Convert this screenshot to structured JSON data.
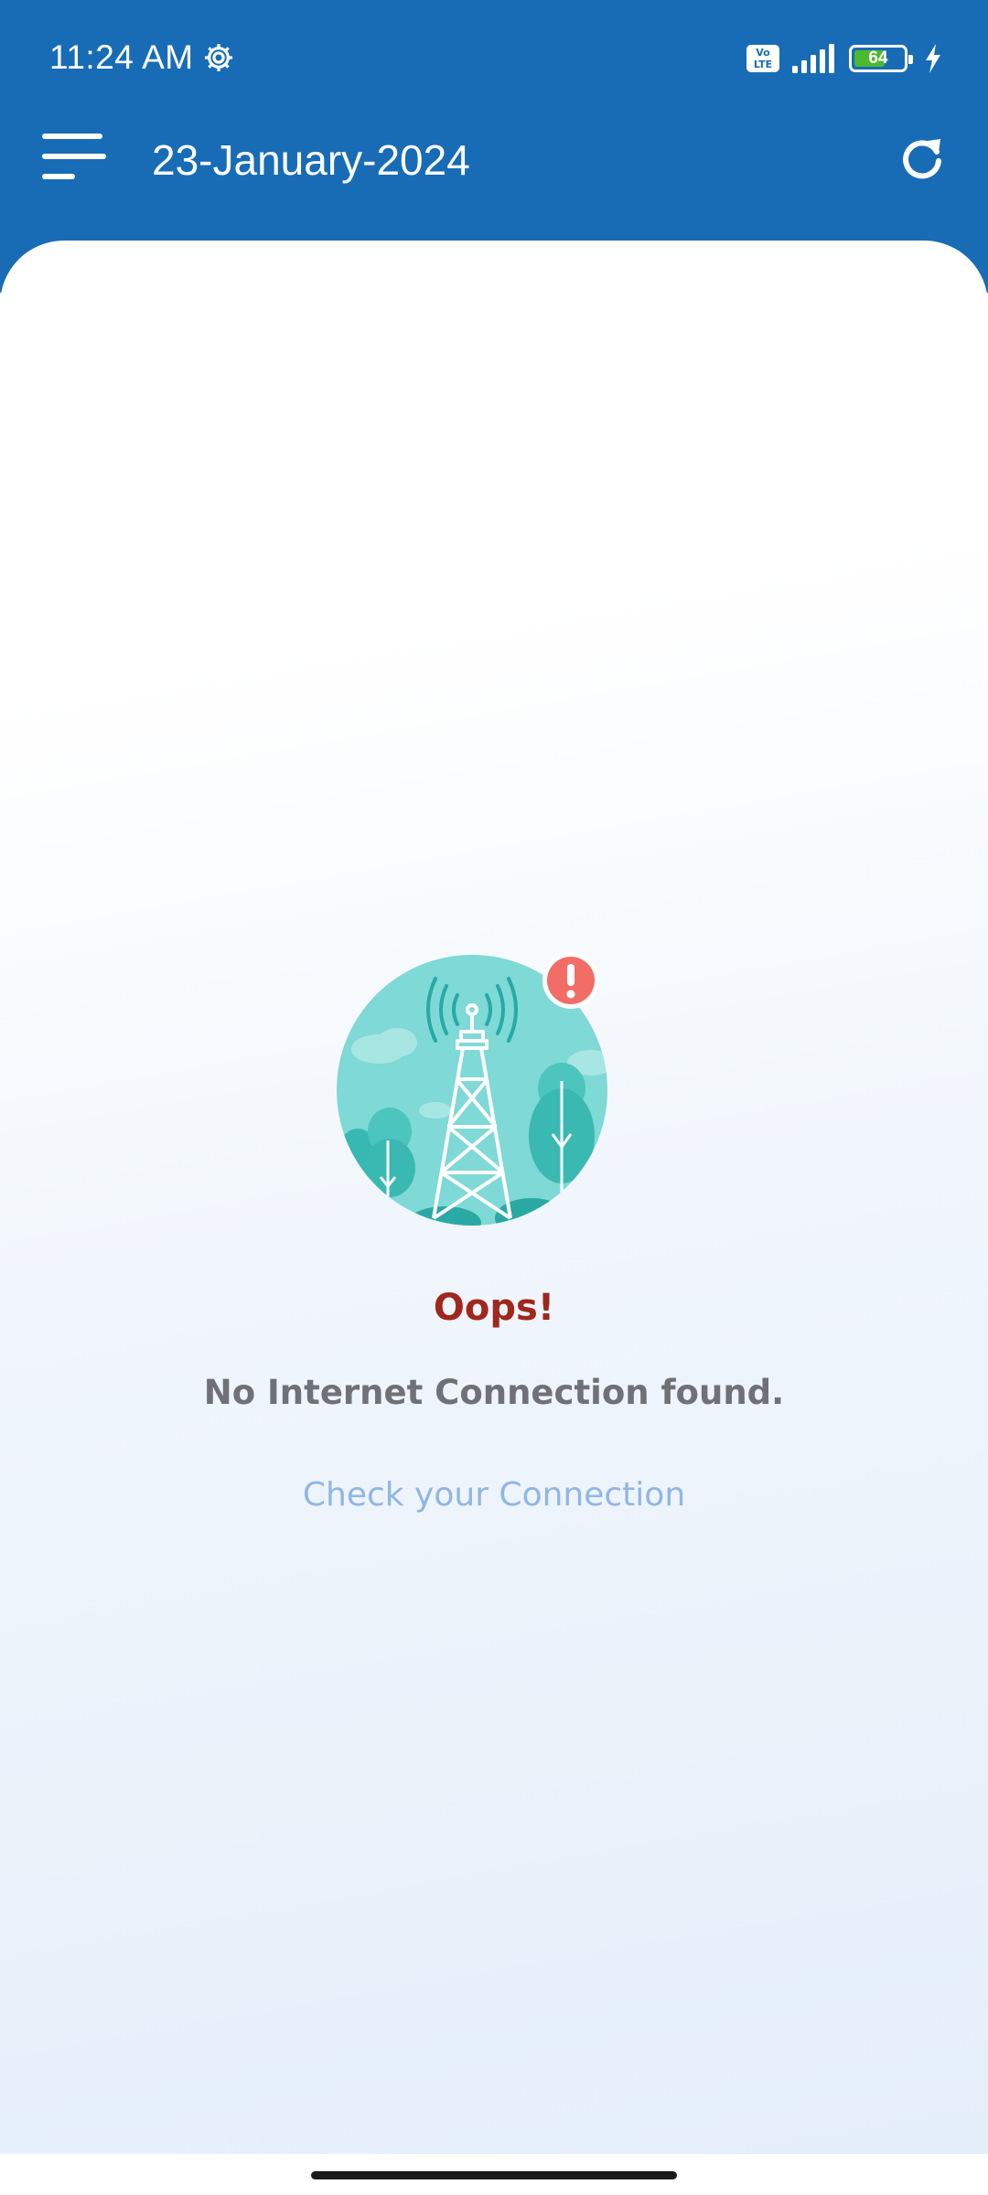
{
  "status_bar": {
    "time": "11:24 AM",
    "volte_label_top": "Vo",
    "volte_label_bottom": "LTE",
    "battery_level": "64",
    "battery_fraction": 0.64,
    "icons": [
      "settings-gear-icon",
      "volte-icon",
      "signal-icon",
      "battery-icon",
      "charging-bolt-icon"
    ]
  },
  "app_bar": {
    "title": "23-January-2024",
    "menu_icon": "hamburger-menu-icon",
    "refresh_icon": "refresh-icon"
  },
  "empty_state": {
    "illustration": "cell-tower-error-illustration",
    "heading": "Oops!",
    "message": "No Internet Connection found.",
    "action": "Check your Connection"
  },
  "colors": {
    "primary": "#186cb6",
    "heading": "#a0271b",
    "message": "#6f7176",
    "link": "#90b6e4",
    "illustration_bg": "#7fd9d6",
    "alert": "#f26d66",
    "battery": "#4cb92e"
  }
}
